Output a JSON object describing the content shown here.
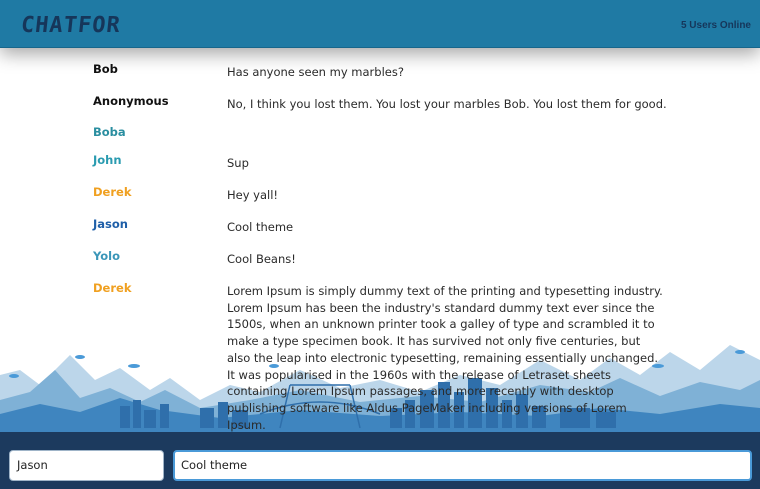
{
  "header": {
    "logo": "CHATFOR",
    "users_online": "5 Users Online"
  },
  "messages": [
    {
      "name": "Bob",
      "text": "Has anyone seen my marbles?",
      "color": "#111111"
    },
    {
      "name": "Anonymous",
      "text": "No, I think you lost them. You lost your marbles Bob. You lost them for good.",
      "color": "#111111"
    },
    {
      "name": "Boba",
      "text": "",
      "color": "#2a8ea0"
    },
    {
      "name": "John",
      "text": "Sup",
      "color": "#2a9bb0"
    },
    {
      "name": "Derek",
      "text": "Hey yall!",
      "color": "#f0a020"
    },
    {
      "name": "Jason",
      "text": "Cool theme",
      "color": "#1f5fa8"
    },
    {
      "name": "Yolo",
      "text": "Cool Beans!",
      "color": "#3a96b8"
    },
    {
      "name": "Derek",
      "text": "Lorem Ipsum is simply dummy text of the printing and typesetting industry. Lorem Ipsum has been the industry's standard dummy text ever since the 1500s, when an unknown printer took a galley of type and scrambled it to make a type specimen book. It has survived not only five centuries, but also the leap into electronic typesetting, remaining essentially unchanged. It was popularised in the 1960s with the release of Letraset sheets containing Lorem Ipsum passages, and more recently with desktop publishing software like Aldus PageMaker including versions of Lorem Ipsum.",
      "color": "#f0a020"
    }
  ],
  "footer": {
    "name_value": "Jason",
    "message_value": "Cool theme"
  },
  "colors": {
    "header_bg": "#1f7aa4",
    "footer_bg": "#1c3a5e",
    "input_focus": "#4a9ad8"
  }
}
